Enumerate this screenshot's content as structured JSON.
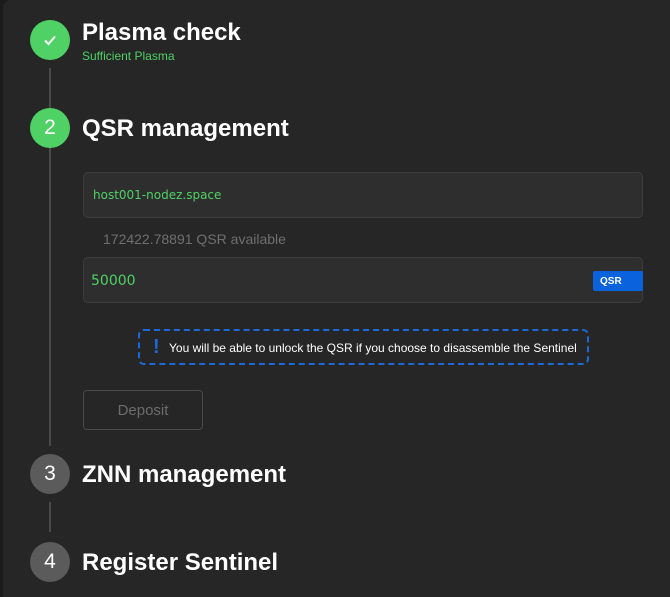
{
  "steps": [
    {
      "number": "1",
      "title": "Plasma check",
      "subtitle": "Sufficient Plasma",
      "state": "done",
      "icon": "check-icon"
    },
    {
      "number": "2",
      "title": "QSR management",
      "state": "active"
    },
    {
      "number": "3",
      "title": "ZNN management",
      "state": "pending"
    },
    {
      "number": "4",
      "title": "Register Sentinel",
      "state": "pending"
    }
  ],
  "qsr": {
    "address": "host001-nodez.space",
    "available_text": "172422.78891 QSR available",
    "amount_value": "50000",
    "token_tag": "QSR",
    "notice_icon": "exclamation-icon",
    "notice_text": "You will be able to unlock the QSR if you choose to disassemble the Sentinel",
    "deposit_label": "Deposit"
  },
  "colors": {
    "success": "#4fd165",
    "accent": "#0a62dd",
    "pending": "#5b5b5b",
    "background": "#262626"
  }
}
